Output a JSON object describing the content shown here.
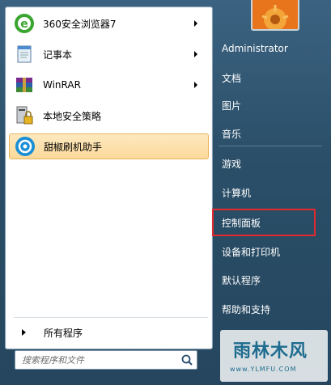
{
  "left_programs": [
    {
      "label": "360安全浏览器7",
      "icon": "browser-360-icon",
      "has_submenu": true
    },
    {
      "label": "记事本",
      "icon": "notepad-icon",
      "has_submenu": true
    },
    {
      "label": "WinRAR",
      "icon": "winrar-icon",
      "has_submenu": true
    },
    {
      "label": "本地安全策略",
      "icon": "security-policy-icon",
      "has_submenu": false
    },
    {
      "label": "甜椒刷机助手",
      "icon": "tianjiao-icon",
      "has_submenu": false
    }
  ],
  "all_programs_label": "所有程序",
  "search": {
    "placeholder": "搜索程序和文件"
  },
  "right_items": [
    {
      "label": "Administrator"
    },
    {
      "label": "文档"
    },
    {
      "label": "图片"
    },
    {
      "label": "音乐"
    },
    {
      "label": "游戏"
    },
    {
      "label": "计算机"
    },
    {
      "label": "控制面板"
    },
    {
      "label": "设备和打印机"
    },
    {
      "label": "默认程序"
    },
    {
      "label": "帮助和支持"
    }
  ],
  "watermark": {
    "text": "雨林木风",
    "url": "www.YLMFU.COM"
  },
  "colors": {
    "highlight_border": "#e2292c",
    "selected_bg": "#fbd99a"
  }
}
